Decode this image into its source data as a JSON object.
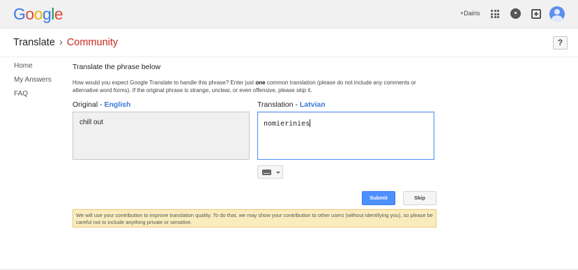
{
  "gbar": {
    "logo_letters": [
      {
        "ch": "G",
        "color": "#3b78e7"
      },
      {
        "ch": "o",
        "color": "#dd4b39"
      },
      {
        "ch": "o",
        "color": "#f4b400"
      },
      {
        "ch": "g",
        "color": "#3b78e7"
      },
      {
        "ch": "l",
        "color": "#0f9d58"
      },
      {
        "ch": "e",
        "color": "#dd4b39"
      }
    ],
    "user_link": "+Dairis",
    "icons": [
      "apps-grid-icon",
      "notifications-icon",
      "share-plus-icon",
      "account-avatar"
    ]
  },
  "header": {
    "translate": "Translate",
    "separator": "›",
    "community": "Community",
    "help": "?"
  },
  "nav": {
    "items": [
      "Home",
      "My Answers",
      "FAQ"
    ]
  },
  "main": {
    "heading": "Translate the phrase below",
    "instructions_a": "How would you expect Google Translate to handle this phrase? Enter just ",
    "instructions_bold": "one",
    "instructions_b": " common translation (please do not include any comments or alternative word forms). If the original phrase is strange, unclear, or even offensive, please ",
    "instructions_italic": "skip",
    "instructions_c": " it.",
    "original_label": "Original - ",
    "original_lang": "English",
    "translation_label": "Translation - ",
    "translation_lang": "Latvian",
    "original_text": "chill out",
    "translation_value": "nomierinies",
    "submit": "Submit",
    "skip": "Skip",
    "notice": "We will use your contribution to improve translation quality. To do that, we may show your contribution to other users (without identifying you), so please be careful not to include anything private or sensitive."
  },
  "colors": {
    "accent_blue": "#4d90fe",
    "language_blue": "#3b78d8",
    "community_red": "#c5281c",
    "notice_bg": "#f9edbe"
  }
}
